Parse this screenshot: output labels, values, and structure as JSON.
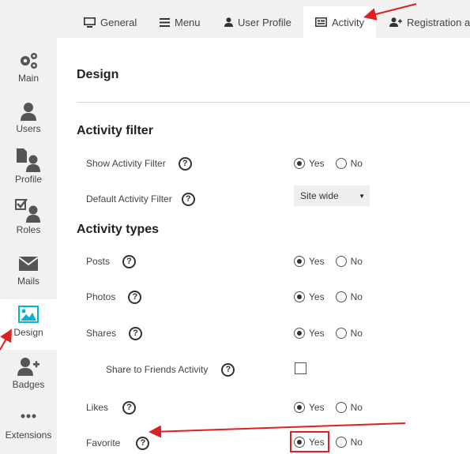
{
  "tabs": [
    {
      "label": "General",
      "icon": "monitor-icon"
    },
    {
      "label": "Menu",
      "icon": "menu-lines-icon"
    },
    {
      "label": "User Profile",
      "icon": "user-icon"
    },
    {
      "label": "Activity",
      "icon": "activity-icon",
      "active": true
    },
    {
      "label": "Registration ar",
      "icon": "user-plus-icon"
    }
  ],
  "sidebar": [
    {
      "label": "Main",
      "icon": "gears-icon"
    },
    {
      "label": "Users",
      "icon": "user-icon"
    },
    {
      "label": "Profile",
      "icon": "profile-icon"
    },
    {
      "label": "Roles",
      "icon": "roles-icon"
    },
    {
      "label": "Mails",
      "icon": "envelope-icon"
    },
    {
      "label": "Design",
      "icon": "image-icon",
      "active": true
    },
    {
      "label": "Badges",
      "icon": "user-plus-icon"
    },
    {
      "label": "Extensions",
      "icon": "dots-icon"
    }
  ],
  "main": {
    "title": "Design",
    "activity_filter": {
      "title": "Activity filter",
      "show_filter": {
        "label": "Show Activity Filter",
        "value": "Yes"
      },
      "default_filter": {
        "label": "Default Activity Filter",
        "value": "Site wide"
      }
    },
    "activity_types": {
      "title": "Activity types",
      "posts": {
        "label": "Posts",
        "value": "Yes"
      },
      "photos": {
        "label": "Photos",
        "value": "Yes"
      },
      "shares": {
        "label": "Shares",
        "value": "Yes"
      },
      "share_friends": {
        "label": "Share to Friends Activity",
        "checked": false
      },
      "likes": {
        "label": "Likes",
        "value": "Yes"
      },
      "favorite": {
        "label": "Favorite",
        "value": "Yes"
      }
    },
    "yes_label": "Yes",
    "no_label": "No",
    "help_glyph": "?"
  },
  "colors": {
    "accent": "#00b3d7",
    "annotation": "#e02020",
    "sidebar_bg": "#f1f1f1"
  }
}
